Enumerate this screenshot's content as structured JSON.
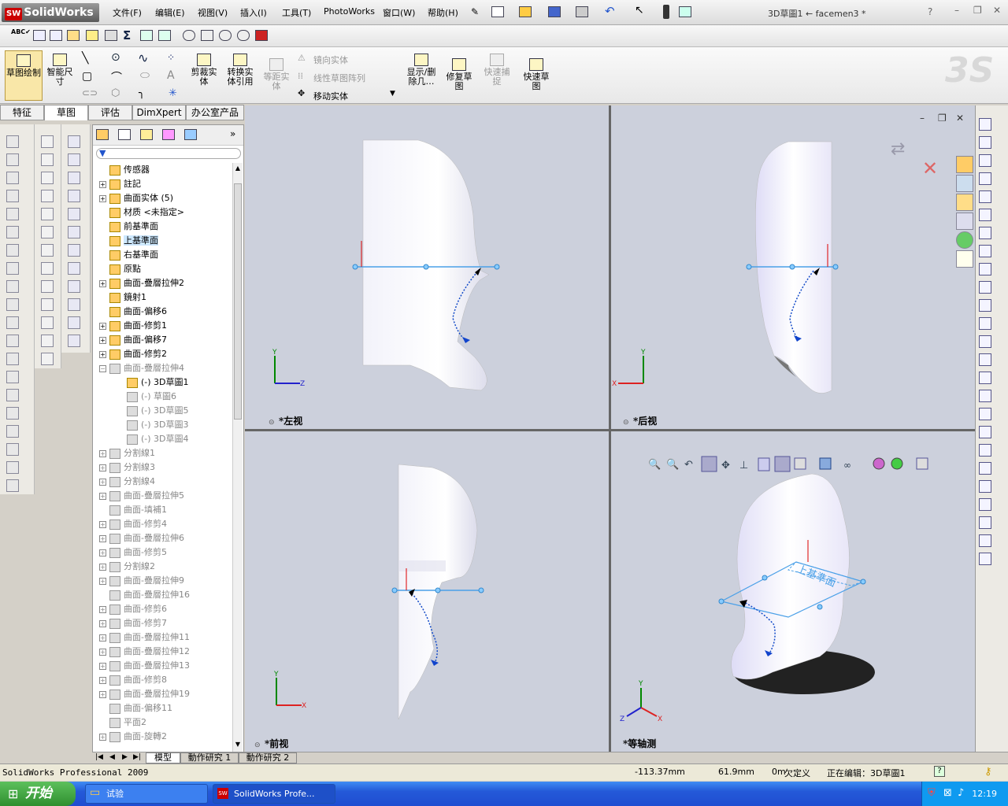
{
  "app": {
    "brand": "SolidWorks",
    "document_title": "3D草圖1 ← facemen3 *"
  },
  "menu": [
    "文件(F)",
    "编辑(E)",
    "视图(V)",
    "插入(I)",
    "工具(T)",
    "PhotoWorks",
    "窗口(W)",
    "帮助(H)"
  ],
  "ribbon": {
    "sketch": "草图绘制",
    "smart_dim": "智能尺寸",
    "trim": "剪裁实体",
    "convert": "转换实体引用",
    "offset": "等距实体",
    "mirror": "镜向实体",
    "linear_pattern": "线性草图阵列",
    "move": "移动实体",
    "display_delete": "显示/删除几…",
    "repair": "修复草图",
    "quick_snap": "快速捕捉",
    "rapid_sketch": "快速草图"
  },
  "tabs": [
    "特征",
    "草图",
    "评估",
    "DimXpert",
    "办公室产品"
  ],
  "tree": [
    {
      "label": "传感器",
      "exp": false,
      "gray": false,
      "indent": 0
    },
    {
      "label": "註記",
      "exp": true,
      "gray": false,
      "indent": 0
    },
    {
      "label": "曲面实体 (5)",
      "exp": true,
      "gray": false,
      "indent": 0
    },
    {
      "label": "材质 <未指定>",
      "exp": false,
      "gray": false,
      "indent": 0
    },
    {
      "label": "前基準面",
      "exp": false,
      "gray": false,
      "indent": 0
    },
    {
      "label": "上基準面",
      "exp": false,
      "gray": false,
      "indent": 0,
      "selected": true
    },
    {
      "label": "右基準面",
      "exp": false,
      "gray": false,
      "indent": 0
    },
    {
      "label": "原點",
      "exp": false,
      "gray": false,
      "indent": 0
    },
    {
      "label": "曲面-疊層拉伸2",
      "exp": true,
      "gray": false,
      "indent": 0
    },
    {
      "label": "鏡射1",
      "exp": false,
      "gray": false,
      "indent": 0
    },
    {
      "label": "曲面-偏移6",
      "exp": false,
      "gray": false,
      "indent": 0
    },
    {
      "label": "曲面-修剪1",
      "exp": true,
      "gray": false,
      "indent": 0
    },
    {
      "label": "曲面-偏移7",
      "exp": true,
      "gray": false,
      "indent": 0
    },
    {
      "label": "曲面-修剪2",
      "exp": true,
      "gray": false,
      "indent": 0
    },
    {
      "label": "曲面-疊層拉伸4",
      "exp": true,
      "gray": true,
      "indent": 0,
      "open": true
    },
    {
      "label": "(-) 3D草圖1",
      "exp": false,
      "gray": false,
      "indent": 1
    },
    {
      "label": "(-) 草圖6",
      "exp": false,
      "gray": true,
      "indent": 1
    },
    {
      "label": "(-) 3D草圖5",
      "exp": false,
      "gray": true,
      "indent": 1
    },
    {
      "label": "(-) 3D草圖3",
      "exp": false,
      "gray": true,
      "indent": 1
    },
    {
      "label": "(-) 3D草圖4",
      "exp": false,
      "gray": true,
      "indent": 1
    },
    {
      "label": "分割線1",
      "exp": true,
      "gray": true,
      "indent": 0
    },
    {
      "label": "分割線3",
      "exp": true,
      "gray": true,
      "indent": 0
    },
    {
      "label": "分割線4",
      "exp": true,
      "gray": true,
      "indent": 0
    },
    {
      "label": "曲面-疊層拉伸5",
      "exp": true,
      "gray": true,
      "indent": 0
    },
    {
      "label": "曲面-填補1",
      "exp": false,
      "gray": true,
      "indent": 0
    },
    {
      "label": "曲面-修剪4",
      "exp": true,
      "gray": true,
      "indent": 0
    },
    {
      "label": "曲面-疊層拉伸6",
      "exp": true,
      "gray": true,
      "indent": 0
    },
    {
      "label": "曲面-修剪5",
      "exp": true,
      "gray": true,
      "indent": 0
    },
    {
      "label": "分割線2",
      "exp": true,
      "gray": true,
      "indent": 0
    },
    {
      "label": "曲面-疊層拉伸9",
      "exp": true,
      "gray": true,
      "indent": 0
    },
    {
      "label": "曲面-疊層拉伸16",
      "exp": false,
      "gray": true,
      "indent": 0
    },
    {
      "label": "曲面-修剪6",
      "exp": true,
      "gray": true,
      "indent": 0
    },
    {
      "label": "曲面-修剪7",
      "exp": true,
      "gray": true,
      "indent": 0
    },
    {
      "label": "曲面-疊層拉伸11",
      "exp": true,
      "gray": true,
      "indent": 0
    },
    {
      "label": "曲面-疊層拉伸12",
      "exp": true,
      "gray": true,
      "indent": 0
    },
    {
      "label": "曲面-疊層拉伸13",
      "exp": true,
      "gray": true,
      "indent": 0
    },
    {
      "label": "曲面-修剪8",
      "exp": true,
      "gray": true,
      "indent": 0
    },
    {
      "label": "曲面-疊層拉伸19",
      "exp": true,
      "gray": true,
      "indent": 0
    },
    {
      "label": "曲面-偏移11",
      "exp": false,
      "gray": true,
      "indent": 0
    },
    {
      "label": "平面2",
      "exp": false,
      "gray": true,
      "indent": 0
    },
    {
      "label": "曲面-旋轉2",
      "exp": true,
      "gray": true,
      "indent": 0
    }
  ],
  "views": {
    "left": "*左视",
    "back": "*后视",
    "front": "*前视",
    "iso": "*等轴测"
  },
  "plane_label": "上基準面",
  "bottom_tabs": [
    "模型",
    "動作研究 1",
    "動作研究 2"
  ],
  "status": {
    "product": "SolidWorks Professional 2009",
    "x": "-113.37mm",
    "y": "61.9mm",
    "z": "0m",
    "define": "欠定义",
    "editing": "正在编辑：3D草圖1"
  },
  "taskbar": {
    "start": "开始",
    "item1": "试验",
    "item2": "SolidWorks Profe...",
    "clock": "12:19"
  }
}
